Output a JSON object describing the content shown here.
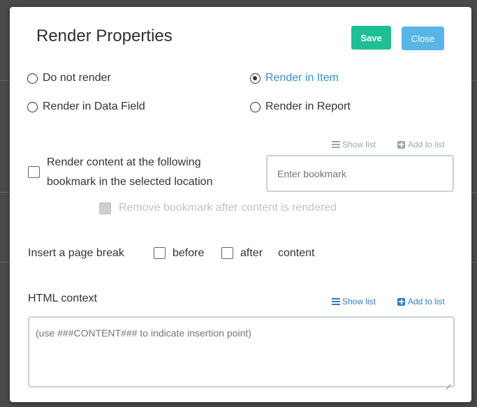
{
  "dialog": {
    "title": "Render Properties",
    "save_label": "Save",
    "close_label": "Close"
  },
  "render_options": [
    {
      "label": "Do not render",
      "checked": false
    },
    {
      "label": "Render in Item",
      "checked": true
    },
    {
      "label": "Render in Data Field",
      "checked": false
    },
    {
      "label": "Render in Report",
      "checked": false
    }
  ],
  "bookmark": {
    "show_list_label": "Show list",
    "add_to_list_label": "Add to list",
    "checkbox_label_line1": "Render content at the following",
    "checkbox_label_line2": "bookmark in the selected location",
    "input_placeholder": "Enter bookmark",
    "remove_label": "Remove bookmark after content is rendered"
  },
  "page_break": {
    "label": "Insert a page break",
    "before_label": "before",
    "after_label": "after",
    "content_label": "content"
  },
  "html_context": {
    "label": "HTML context",
    "show_list_label": "Show list",
    "add_to_list_label": "Add to list",
    "textarea_placeholder": "(use ###CONTENT### to indicate insertion point)"
  },
  "colors": {
    "save_button": "#1fbf95",
    "close_button": "#58b5e6",
    "selected_radio_text": "#3a8fd0",
    "active_link": "#2c7ec4"
  }
}
